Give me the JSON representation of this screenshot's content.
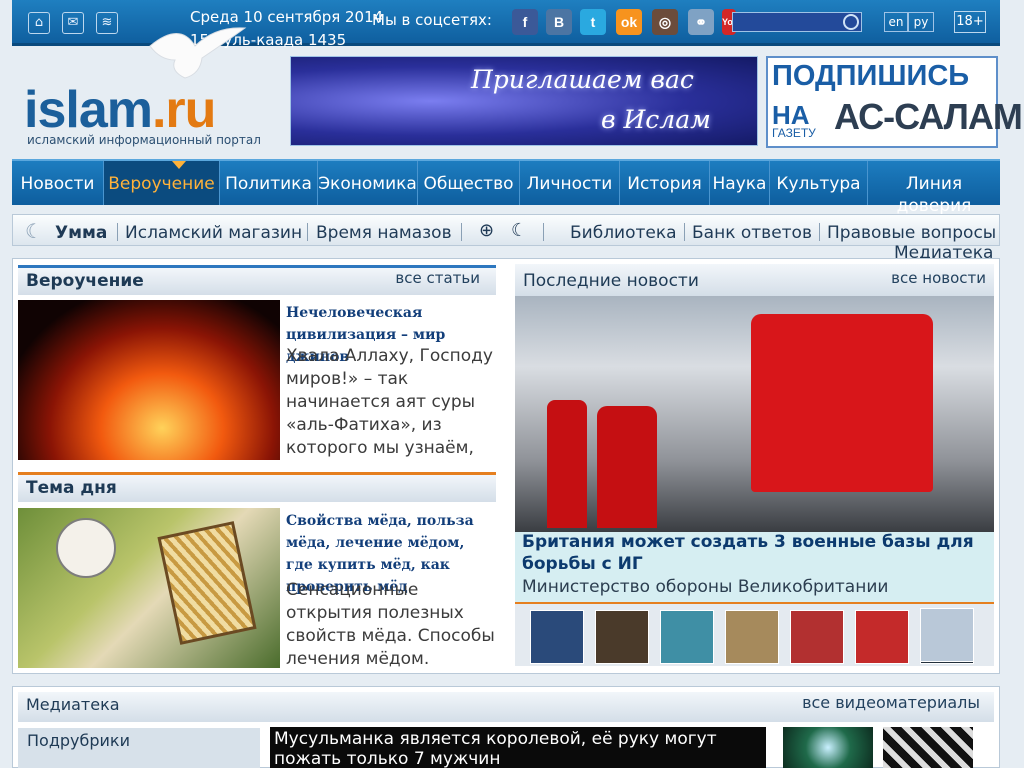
{
  "topbar": {
    "date_line1": "Среда 10 сентября 2014",
    "date_line2": "15 Зуль-каада 1435",
    "social_label": "Мы в соцсетях:",
    "social": [
      {
        "label": "f",
        "icon": "facebook-icon",
        "color": "#3b5998"
      },
      {
        "label": "B",
        "icon": "vkontakte-icon",
        "color": "#4c75a3"
      },
      {
        "label": "t",
        "icon": "twitter-icon",
        "color": "#2aa9e0"
      },
      {
        "label": "ok",
        "icon": "odnoklassniki-icon",
        "color": "#f7931e"
      },
      {
        "label": "◎",
        "icon": "instagram-icon",
        "color": "#6b4c3b"
      },
      {
        "label": "⚭",
        "icon": "livejournal-icon",
        "color": "#7fa2c4"
      },
      {
        "label": "You",
        "icon": "youtube-icon",
        "color": "#d32727"
      }
    ],
    "lang_en": "en",
    "lang_ru": "ру",
    "age_rating": "18+"
  },
  "header": {
    "logo_main": "islam",
    "logo_suffix": ".ru",
    "tagline": "исламский информационный портал",
    "banner1_line1": "Приглашаем вас",
    "banner1_line2": "в Ислам",
    "banner2_line1": "ПОДПИШИСЬ",
    "banner2_line2": "НА",
    "banner2_line3": "ГАЗЕТУ",
    "banner2_line4": "АС-САЛАМ"
  },
  "nav": {
    "items": [
      {
        "label": "Новости"
      },
      {
        "label": "Вероучение",
        "active": true
      },
      {
        "label": "Политика"
      },
      {
        "label": "Экономика"
      },
      {
        "label": "Общество"
      },
      {
        "label": "Личности"
      },
      {
        "label": "История"
      },
      {
        "label": "Наука"
      },
      {
        "label": "Культура"
      },
      {
        "label": "Линия доверия"
      }
    ]
  },
  "subnav": {
    "umma": "Умма",
    "shop": "Исламский магазин",
    "prayer": "Время намазов",
    "library": "Библиотека",
    "answers": "Банк ответов",
    "legal": "Правовые вопросы",
    "media": "Медиатека"
  },
  "doctrine": {
    "title": "Вероучение",
    "all_link": "все статьи",
    "article_title": "Нечеловеческая цивилизация – мир джинов",
    "article_text": "Хвала Аллаху, Господу миров!» – так начинается аят суры «аль-Фатиха», из которого мы узнаём, что помимо нашего"
  },
  "topic": {
    "title": "Тема дня",
    "article_title": "Свойства мёда, польза мёда, лечение мёдом, где купить мёд, как проверить мёд",
    "article_text": "Сенсационные открытия полезных свойств мёда. Способы лечения мёдом."
  },
  "news": {
    "title": "Последние новости",
    "all_link": "все новости",
    "headline": "Британия может создать 3 военные базы для борьбы с ИГ",
    "subline": "Министерство обороны Великобритании",
    "thumb_colors": [
      "#2a4a7a",
      "#4a3a2a",
      "#3f8fa5",
      "#a68a5c",
      "#b23030",
      "#c42a2a",
      "#23303c",
      "#b9c8d8"
    ]
  },
  "media": {
    "title": "Медиатека",
    "all_link": "все видеоматериалы",
    "subheading": "Подрубрики",
    "video_title": "Мусульманка является королевой, её руку могут пожать только 7 мужчин"
  },
  "colors": {
    "brand_blue": "#1b5f9b",
    "accent_orange": "#e57f1f"
  }
}
